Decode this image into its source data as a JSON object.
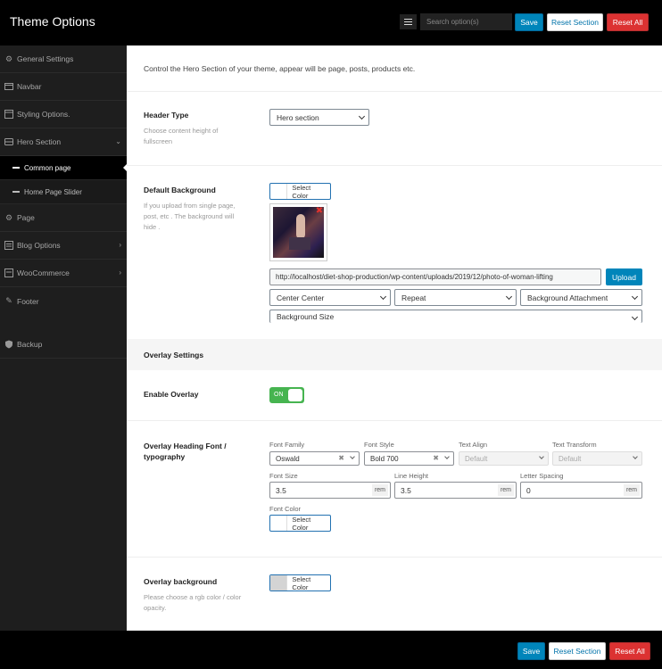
{
  "app": {
    "title": "Theme Options"
  },
  "toolbar": {
    "search_placeholder": "Search option(s)",
    "save_label": "Save",
    "reset_section_label": "Reset Section",
    "reset_all_label": "Reset All",
    "list_icon": "list-icon"
  },
  "sidebar": {
    "items": [
      {
        "label": "General Settings",
        "icon": "gear-icon"
      },
      {
        "label": "Navbar",
        "icon": "navbar-icon"
      },
      {
        "label": "Styling Options.",
        "icon": "styling-icon"
      },
      {
        "label": "Hero Section",
        "icon": "hero-icon",
        "expanded": true
      },
      {
        "label": "Page",
        "icon": "gears-icon"
      },
      {
        "label": "Blog Options",
        "icon": "blog-icon"
      },
      {
        "label": "WooCommerce",
        "icon": "woocommerce-icon"
      },
      {
        "label": "Footer",
        "icon": "edit-icon"
      },
      {
        "label": "Backup",
        "icon": "shield-icon"
      }
    ],
    "subitems": [
      {
        "label": "Common page",
        "active": true
      },
      {
        "label": "Home Page Slider",
        "active": false
      }
    ]
  },
  "main": {
    "section_description": "Control the Hero Section of your theme, appear will be page, posts, products etc.",
    "header_type": {
      "title": "Header Type",
      "description": "Choose content height of fullscreen",
      "value": "Hero section"
    },
    "default_background": {
      "title": "Default Background",
      "description": "If you upload from single page, post, etc . The background will hide .",
      "select_color_label": "Select Color",
      "url": "http://localhost/diet-shop-production/wp-content/uploads/2019/12/photo-of-woman-lifting",
      "upload_label": "Upload",
      "position": "Center Center",
      "repeat": "Repeat",
      "attachment": "Background Attachment",
      "size": "Background Size"
    },
    "overlay_settings": {
      "title": "Overlay Settings"
    },
    "enable_overlay": {
      "title": "Enable Overlay",
      "toggle_label": "ON",
      "enabled": true
    },
    "overlay_heading_font": {
      "title": "Overlay Heading Font / typography",
      "font_family_label": "Font Family",
      "font_family": "Oswald",
      "font_style_label": "Font Style",
      "font_style": "Bold 700",
      "text_align_label": "Text Align",
      "text_align": "Default",
      "text_transform_label": "Text Transform",
      "text_transform": "Default",
      "font_size_label": "Font Size",
      "font_size": "3.5",
      "line_height_label": "Line Height",
      "line_height": "3.5",
      "letter_spacing_label": "Letter Spacing",
      "letter_spacing": "0",
      "unit": "rem",
      "font_color_label": "Font Color",
      "select_color_label": "Select Color"
    },
    "overlay_background": {
      "title": "Overlay background",
      "description": "Please choose a rgb color / color opacity.",
      "select_color_label": "Select Color"
    }
  },
  "colors": {
    "accent": "#0085ba",
    "danger": "#dc3232",
    "toggle_on": "#46b450"
  }
}
